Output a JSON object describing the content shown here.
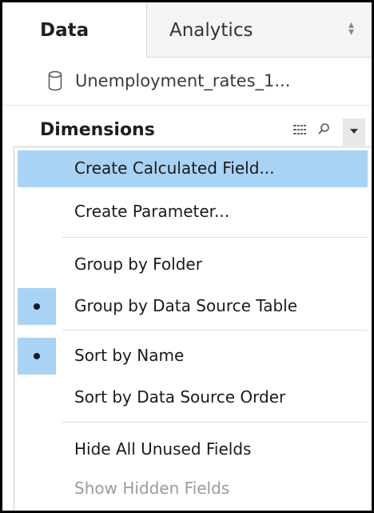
{
  "tabs": {
    "data_label": "Data",
    "analytics_label": "Analytics"
  },
  "datasource": {
    "name": "Unemployment_rates_1..."
  },
  "dimensions": {
    "title": "Dimensions"
  },
  "menu": {
    "items": [
      {
        "label": "Create Calculated Field...",
        "highlighted": true
      },
      {
        "label": "Create Parameter..."
      },
      {
        "label": "Group by Folder"
      },
      {
        "label": "Group by Data Source Table",
        "checked": true
      },
      {
        "label": "Sort by Name",
        "checked": true
      },
      {
        "label": "Sort by Data Source Order"
      },
      {
        "label": "Hide All Unused Fields"
      },
      {
        "label": "Show Hidden Fields",
        "disabled": true
      }
    ]
  },
  "colors": {
    "highlight": "#a9d3f5",
    "disabled_text": "#9b9b9b"
  }
}
